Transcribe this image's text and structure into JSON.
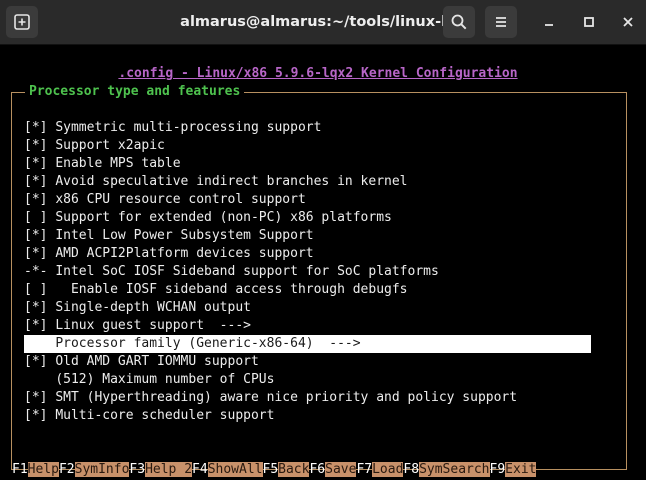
{
  "window": {
    "title": "almarus@almarus:~/tools/linux-lqx"
  },
  "config_title": ".config - Linux/x86 5.9.6-lqx2 Kernel Configuration",
  "section_title": "Processor type and features",
  "items": [
    {
      "marker": "[*]",
      "label": "Symmetric multi-processing support"
    },
    {
      "marker": "[*]",
      "label": "Support x2apic"
    },
    {
      "marker": "[*]",
      "label": "Enable MPS table"
    },
    {
      "marker": "[*]",
      "label": "Avoid speculative indirect branches in kernel"
    },
    {
      "marker": "[*]",
      "label": "x86 CPU resource control support"
    },
    {
      "marker": "[ ]",
      "label": "Support for extended (non-PC) x86 platforms"
    },
    {
      "marker": "[*]",
      "label": "Intel Low Power Subsystem Support"
    },
    {
      "marker": "[*]",
      "label": "AMD ACPI2Platform devices support"
    },
    {
      "marker": "-*-",
      "label": "Intel SoC IOSF Sideband support for SoC platforms"
    },
    {
      "marker": "[ ]",
      "label": "  Enable IOSF sideband access through debugfs"
    },
    {
      "marker": "[*]",
      "label": "Single-depth WCHAN output"
    },
    {
      "marker": "[*]",
      "label": "Linux guest support  --->"
    },
    {
      "marker": "   ",
      "label": "Processor family (Generic-x86-64)  --->"
    },
    {
      "marker": "[*]",
      "label": "Old AMD GART IOMMU support"
    },
    {
      "marker": "   ",
      "label": "(512) Maximum number of CPUs"
    },
    {
      "marker": "[*]",
      "label": "SMT (Hyperthreading) aware nice priority and policy support"
    },
    {
      "marker": "[*]",
      "label": "Multi-core scheduler support"
    }
  ],
  "selected_index": 12,
  "fkeys": [
    {
      "key": "F1",
      "label": "Help"
    },
    {
      "key": "F2",
      "label": "SymInfo"
    },
    {
      "key": "F3",
      "label": "Help 2"
    },
    {
      "key": "F4",
      "label": "ShowAll"
    },
    {
      "key": "F5",
      "label": "Back"
    },
    {
      "key": "F6",
      "label": "Save"
    },
    {
      "key": "F7",
      "label": "Load"
    },
    {
      "key": "F8",
      "label": "SymSearch"
    },
    {
      "key": "F9",
      "label": "Exit"
    }
  ]
}
